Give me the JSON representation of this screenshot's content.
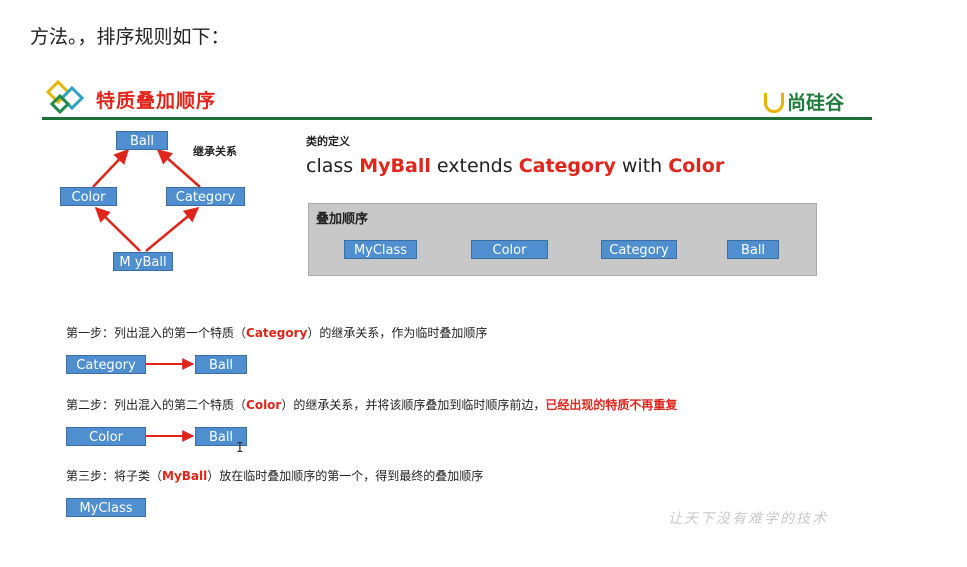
{
  "intro_text": "方法。，排序规则如下：",
  "slide_title": "特质叠加顺序",
  "brand_name": "尚硅谷",
  "colors": {
    "accent_red": "#e0261b",
    "box_blue": "#4f8fd0",
    "header_green": "#1e6e3a"
  },
  "hierarchy": {
    "label": "继承关系",
    "ball": "Ball",
    "color": "Color",
    "category": "Category",
    "myball": "M yBall"
  },
  "class_definition": {
    "label": "类的定义",
    "kw_class": "class",
    "name": "MyBall",
    "kw_extends": "extends",
    "parent": "Category",
    "kw_with": "with",
    "trait": "Color"
  },
  "stack_order": {
    "title": "叠加顺序",
    "items": [
      "MyClass",
      "Color",
      "Category",
      "Ball"
    ]
  },
  "steps": [
    {
      "prefix": "第一步：列出混入的第一个特质（",
      "highlight": "Category",
      "suffix": "）的继承关系，作为临时叠加顺序",
      "note": "",
      "boxes": [
        "Category",
        "Ball"
      ]
    },
    {
      "prefix": "第二步：列出混入的第二个特质（",
      "highlight": "Color",
      "suffix": "）的继承关系，并将该顺序叠加到临时顺序前边，",
      "note": "已经出现的特质不再重复",
      "boxes": [
        "Color",
        "Ball"
      ]
    },
    {
      "prefix": "第三步：将子类（",
      "highlight": "MyBall",
      "suffix": "）放在临时叠加顺序的第一个，得到最终的叠加顺序",
      "note": "",
      "boxes": [
        "MyClass"
      ]
    }
  ],
  "cursor_glyph": "I",
  "watermark": "让天下没有难学的技术"
}
